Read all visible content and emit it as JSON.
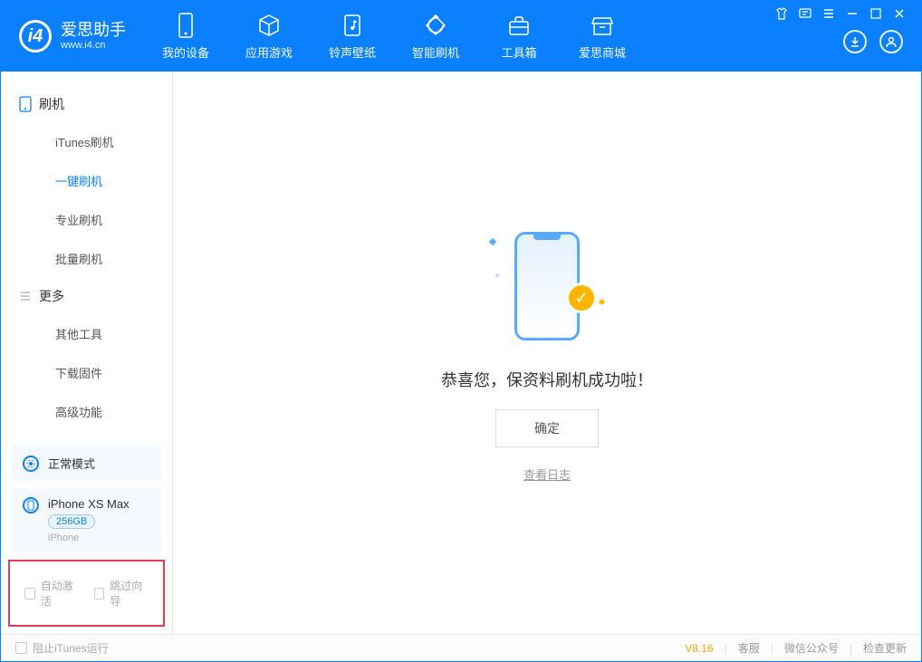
{
  "app": {
    "title": "爱思助手",
    "subtitle": "www.i4.cn"
  },
  "nav": {
    "tabs": [
      {
        "label": "我的设备",
        "icon": "device-icon"
      },
      {
        "label": "应用游戏",
        "icon": "cube-icon"
      },
      {
        "label": "铃声壁纸",
        "icon": "music-icon"
      },
      {
        "label": "智能刷机",
        "icon": "refresh-icon"
      },
      {
        "label": "工具箱",
        "icon": "toolbox-icon"
      },
      {
        "label": "爱思商城",
        "icon": "store-icon"
      }
    ]
  },
  "sidebar": {
    "groups": [
      {
        "title": "刷机",
        "items": [
          {
            "label": "iTunes刷机",
            "active": false
          },
          {
            "label": "一键刷机",
            "active": true
          },
          {
            "label": "专业刷机",
            "active": false
          },
          {
            "label": "批量刷机",
            "active": false
          }
        ]
      },
      {
        "title": "更多",
        "items": [
          {
            "label": "其他工具",
            "active": false
          },
          {
            "label": "下载固件",
            "active": false
          },
          {
            "label": "高级功能",
            "active": false
          }
        ]
      }
    ],
    "mode_box": {
      "label": "正常模式"
    },
    "device_box": {
      "name": "iPhone XS Max",
      "storage": "256GB",
      "type": "iPhone"
    },
    "checkboxes": {
      "auto_activate": "自动激活",
      "skip_guide": "跳过向导"
    }
  },
  "content": {
    "success_msg": "恭喜您，保资料刷机成功啦！",
    "ok_button": "确定",
    "view_log": "查看日志"
  },
  "footer": {
    "block_itunes": "阻止iTunes运行",
    "version": "V8.16",
    "links": {
      "support": "客服",
      "wechat": "微信公众号",
      "update": "检查更新"
    }
  }
}
